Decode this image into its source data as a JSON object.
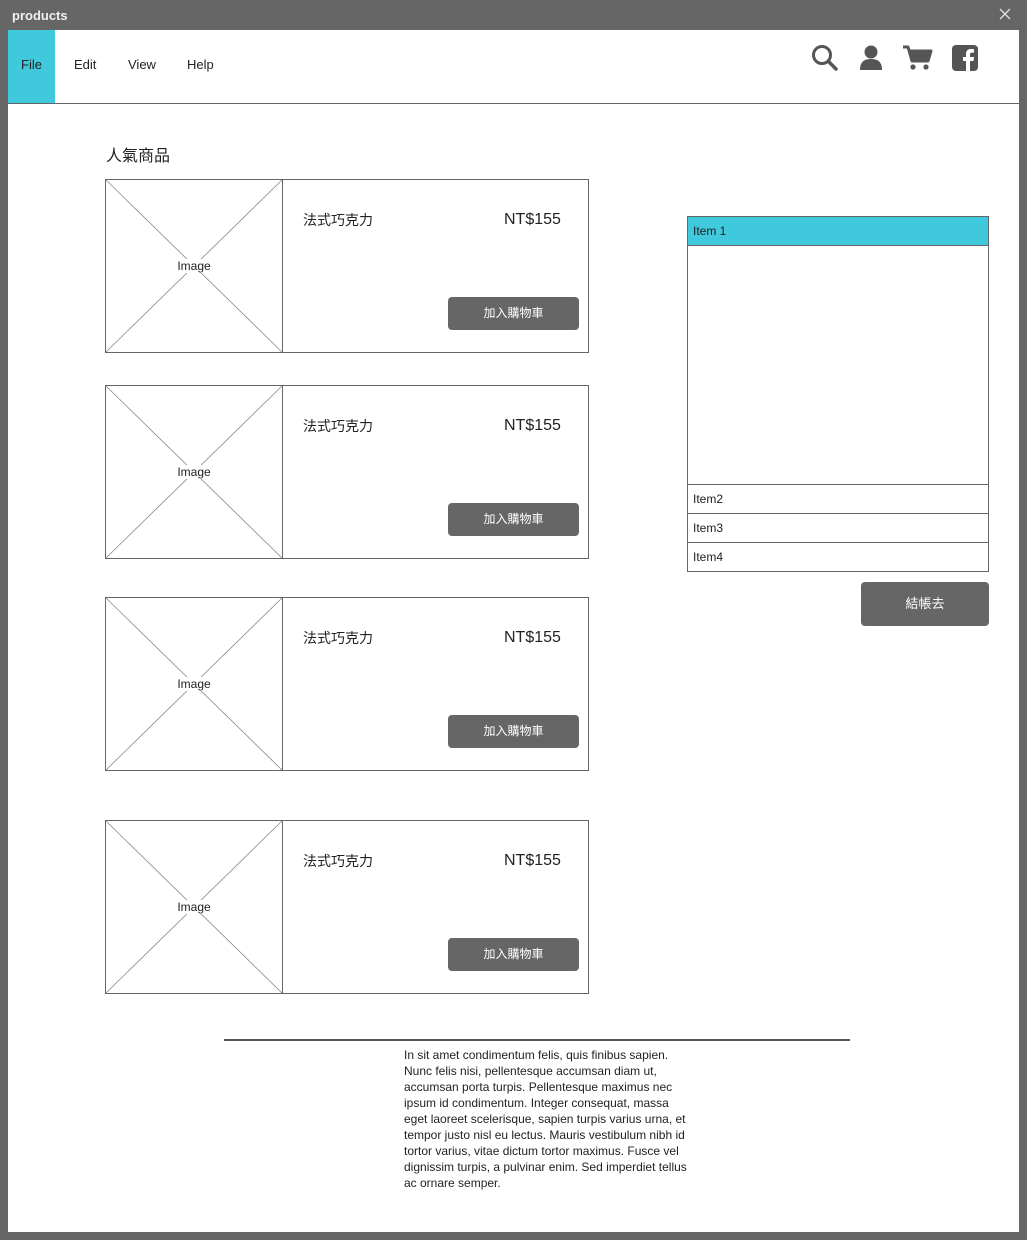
{
  "window": {
    "title": "products"
  },
  "menu": {
    "items": [
      {
        "label": "File",
        "active": true
      },
      {
        "label": "Edit",
        "active": false
      },
      {
        "label": "View",
        "active": false
      },
      {
        "label": "Help",
        "active": false
      }
    ]
  },
  "toolbar_icons": [
    "search-icon",
    "user-icon",
    "cart-icon",
    "facebook-icon"
  ],
  "section": {
    "title": "人氣商品"
  },
  "products": [
    {
      "image_label": "Image",
      "name": "法式巧克力",
      "price": "NT$155",
      "button": "加入購物車"
    },
    {
      "image_label": "Image",
      "name": "法式巧克力",
      "price": "NT$155",
      "button": "加入購物車"
    },
    {
      "image_label": "Image",
      "name": "法式巧克力",
      "price": "NT$155",
      "button": "加入購物車"
    },
    {
      "image_label": "Image",
      "name": "法式巧克力",
      "price": "NT$155",
      "button": "加入購物車"
    }
  ],
  "cart": {
    "items": [
      "Item 1",
      "Item2",
      "Item3",
      "Item4"
    ],
    "selected_index": 0,
    "checkout_label": "結帳去"
  },
  "footer": {
    "text": "In sit amet condimentum felis, quis finibus sapien. Nunc felis nisi, pellentesque accumsan diam ut, accumsan porta turpis. Pellentesque maximus nec ipsum id condimentum. Integer consequat, massa eget laoreet scelerisque, sapien turpis varius urna, et tempor justo nisl eu lectus. Mauris vestibulum nibh id tortor varius, vitae dictum tortor maximus. Fusce vel dignissim turpis, a pulvinar enim. Sed imperdiet tellus ac ornare semper."
  },
  "colors": {
    "accent": "#40c8dc",
    "chrome": "#666666",
    "button": "#666666"
  }
}
